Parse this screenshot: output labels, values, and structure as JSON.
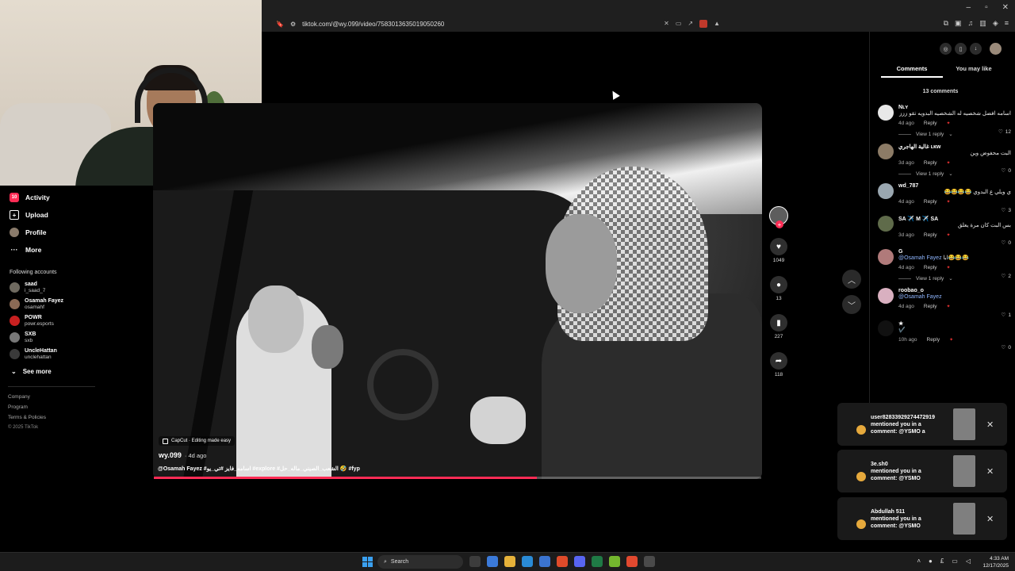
{
  "browser": {
    "url": "tiktok.com/@wy.099/video/7583013635019050260",
    "window_controls": [
      "–",
      "▫",
      "✕"
    ]
  },
  "sidebar": {
    "nav": [
      {
        "label": "Activity",
        "icon": "activity-icon",
        "badge": "10"
      },
      {
        "label": "Upload",
        "icon": "upload-icon"
      },
      {
        "label": "Profile",
        "icon": "profile-icon"
      },
      {
        "label": "More",
        "icon": "more-icon"
      }
    ],
    "following_title": "Following accounts",
    "following": [
      {
        "name": "saad",
        "handle": "i_saad_7",
        "color": "#6f6a60"
      },
      {
        "name": "Osamah Fayez",
        "handle": "osamahf",
        "color": "#8b6a55"
      },
      {
        "name": "POWR",
        "handle": "powr.esports",
        "color": "#c82020"
      },
      {
        "name": "SXB",
        "handle": "sxb",
        "color": "#777777"
      },
      {
        "name": "UncleHattan",
        "handle": "unclehattan",
        "color": "#3a3a3a"
      }
    ],
    "see_more": "See more",
    "footer": [
      "Company",
      "Program",
      "Terms & Policies"
    ],
    "copyright": "© 2025 TikTok"
  },
  "video": {
    "capcut": "CapCut · Editing made easy",
    "author": "wy.099",
    "date": "· 4d ago",
    "caption": "@Osamah Fayez #اسامه_فايز #تي_يو #explore #الشعب_الصيني_ماله_حل 🤣 #fyp",
    "progress": 0.63
  },
  "actions": {
    "likes": "1049",
    "comments": "13",
    "saves": "227",
    "shares": "118"
  },
  "panel": {
    "tabs": [
      "Comments",
      "You may like"
    ],
    "active_tab": 0,
    "comment_count": "13 comments",
    "comments": [
      {
        "user": "Nʟʏ",
        "text": "اسامه افضل شخصيه له الشخصيه البدويه تقو ززز",
        "date": "4d ago",
        "likes": "12",
        "view_reply": "View 1 reply",
        "color": "#e8e8e8"
      },
      {
        "user": "غالية الهاجري ʟᴋw",
        "text": "البت محفوض وين",
        "date": "3d ago",
        "likes": "0",
        "view_reply": "View 1 reply",
        "color": "#8c7b66"
      },
      {
        "user": "wd_787",
        "text": "ي ويلي ع البدوي 😂😂😂😂",
        "date": "4d ago",
        "likes": "3",
        "view_reply": "",
        "color": "#9aa7b0"
      },
      {
        "user": "SA ✈️ M ✈️ SA",
        "text": "بس البت كان مرة يعلق",
        "date": "3d ago",
        "likes": "0",
        "view_reply": "",
        "color": "#5f6b4a"
      },
      {
        "user": "G",
        "mention": "@Osamah Fayez",
        "text": "ابا😂😂😂",
        "date": "4d ago",
        "likes": "2",
        "view_reply": "View 1 reply",
        "color": "#b07a7a"
      },
      {
        "user": "roobao_o",
        "mention": "@Osamah Fayez",
        "text": "",
        "date": "4d ago",
        "likes": "1",
        "view_reply": "",
        "color": "#d9b0c0"
      },
      {
        "user": "★",
        "text": "✔️",
        "date": "10h ago",
        "likes": "0",
        "view_reply": "",
        "color": "#111111"
      }
    ],
    "reply_label": "Reply"
  },
  "toasts": [
    {
      "user": "user8283392927447291​9",
      "line1": "mentioned you in a",
      "line2": "comment: @YSMO a"
    },
    {
      "user": "3e.sh0",
      "line1": "mentioned you in a",
      "line2": "comment: @YSMO"
    },
    {
      "user": "Abdullah 511",
      "line1": "mentioned you in a",
      "line2": "comment: @YSMO"
    }
  ],
  "taskbar": {
    "search": "Search",
    "time": "4:33 AM",
    "date": "12/17/2025"
  }
}
